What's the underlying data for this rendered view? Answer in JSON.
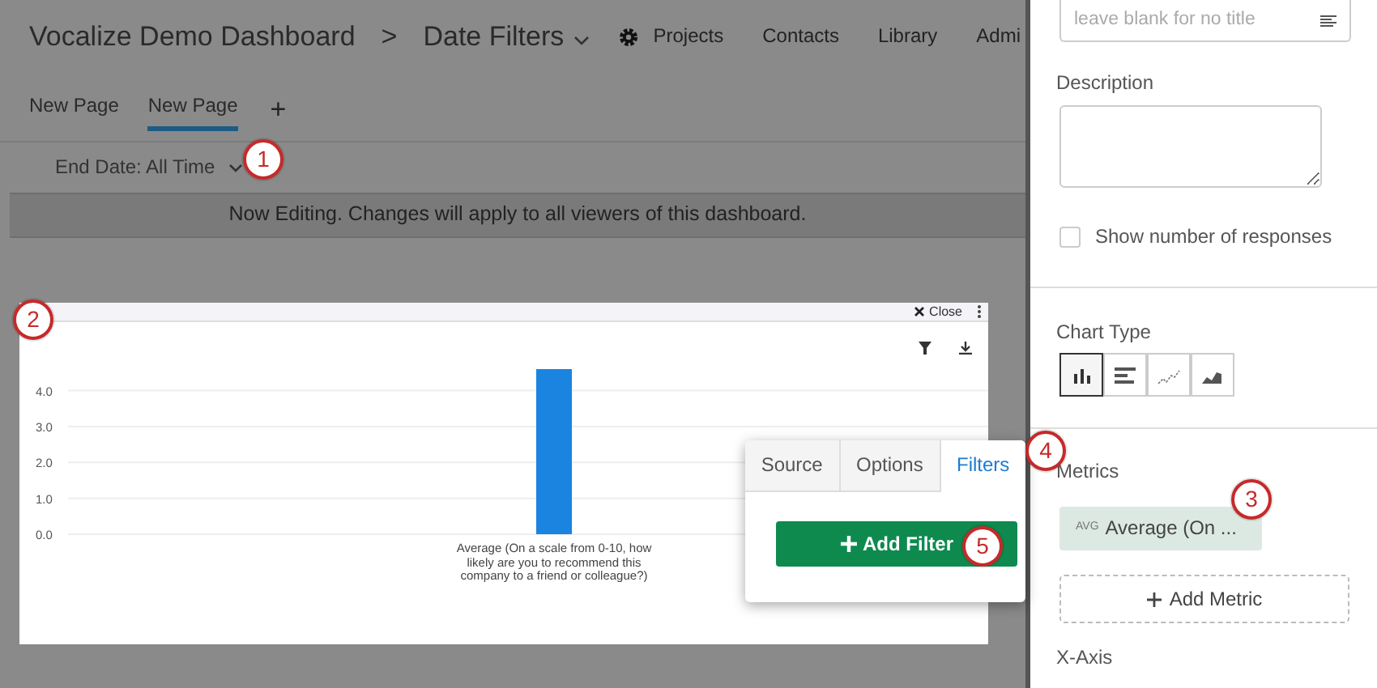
{
  "header": {
    "title": "Vocalize Demo Dashboard",
    "separator": ">",
    "page": "Date Filters",
    "nav": [
      "Projects",
      "Contacts",
      "Library",
      "Admi"
    ]
  },
  "page_tabs": [
    {
      "label": "New Page",
      "selected": false
    },
    {
      "label": "New Page",
      "selected": true
    }
  ],
  "add_page": "+",
  "date_filter": {
    "label": "End Date: All Time"
  },
  "banner": "Now Editing. Changes will apply to all viewers of this dashboard.",
  "widget": {
    "close": "Close",
    "chart_data": {
      "type": "bar",
      "grid": true,
      "categories": [
        "Average (On a scale from 0-10, how likely are you to recommend this company to a friend or colleague?)"
      ],
      "values": [
        4.6
      ],
      "ylim": [
        0,
        4.6
      ],
      "yticks": [
        {
          "value": 0,
          "label": "0.0"
        },
        {
          "value": 1,
          "label": "1.0"
        },
        {
          "value": 2,
          "label": "2.0"
        },
        {
          "value": 3,
          "label": "3.0"
        },
        {
          "value": 4,
          "label": "4.0"
        }
      ]
    }
  },
  "popover": {
    "tabs": [
      {
        "label": "Source",
        "selected": false
      },
      {
        "label": "Options",
        "selected": false
      },
      {
        "label": "Filters",
        "selected": true
      }
    ],
    "button": "Add Filter"
  },
  "panel": {
    "title_placeholder": "leave blank for no title",
    "description_label": "Description",
    "show_responses": {
      "label": "Show number of responses",
      "checked": false
    },
    "chart_type_label": "Chart Type",
    "chart_types": [
      {
        "kind": "bar",
        "selected": true
      },
      {
        "kind": "horizontal",
        "selected": false
      },
      {
        "kind": "line",
        "selected": false
      },
      {
        "kind": "area",
        "selected": false
      }
    ],
    "metrics_label": "Metrics",
    "metrics": [
      {
        "tag": "AVG",
        "label": "Average (On ..."
      }
    ],
    "add_metric": "Add Metric",
    "x_axis_label": "X-Axis"
  },
  "callouts": [
    "1",
    "2",
    "3",
    "4",
    "5"
  ]
}
